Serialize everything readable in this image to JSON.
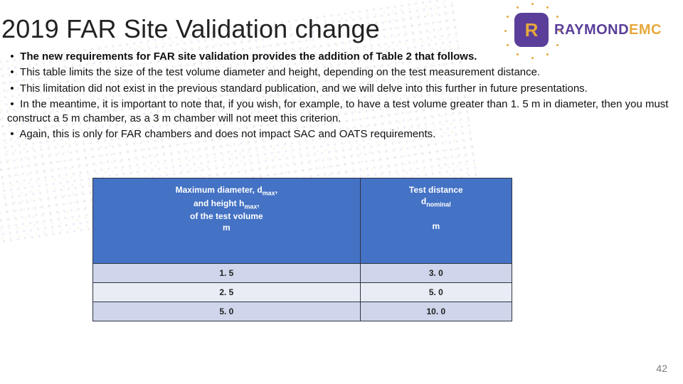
{
  "title": "2019 FAR Site Validation change",
  "logo": {
    "brand_main": "RAYMOND",
    "brand_suffix": "EMC"
  },
  "bullets": [
    {
      "bold": true,
      "text": "The new requirements for FAR site validation provides the addition of Table 2 that follows."
    },
    {
      "bold": false,
      "text": "This table limits the size of the test volume diameter and height, depending on the test measurement distance."
    },
    {
      "bold": false,
      "text": "This limitation did not exist in the previous standard publication, and we will delve into this further in future presentations."
    },
    {
      "bold": false,
      "text": "In the meantime, it is important to note that, if you wish, for example, to have a test volume greater than 1. 5 m in diameter, then you must construct a 5 m chamber, as a 3 m chamber will not meet this criterion."
    },
    {
      "bold": false,
      "text": "Again, this is only for FAR chambers and does not impact SAC and OATS requirements."
    }
  ],
  "table": {
    "headers": {
      "col1": {
        "l1": "Maximum diameter, d",
        "l1_sub": "max",
        "l1_tail": ",",
        "l2a": "and height h",
        "l2_sub": "max",
        "l2_tail": ",",
        "l3": "of the test volume",
        "unit": "m"
      },
      "col2": {
        "l1": "Test distance",
        "l2a": "d",
        "l2_sub": "nominal",
        "unit": "m"
      }
    },
    "rows": [
      {
        "c1": "1. 5",
        "c2": "3. 0"
      },
      {
        "c1": "2. 5",
        "c2": "5. 0"
      },
      {
        "c1": "5. 0",
        "c2": "10. 0"
      }
    ]
  },
  "page_number": "42",
  "chart_data": {
    "type": "table",
    "title": "2019 FAR Site Validation – Table 2",
    "columns": [
      "Maximum diameter d_max and height h_max of the test volume (m)",
      "Test distance d_nominal (m)"
    ],
    "rows": [
      [
        1.5,
        3.0
      ],
      [
        2.5,
        5.0
      ],
      [
        5.0,
        10.0
      ]
    ]
  }
}
